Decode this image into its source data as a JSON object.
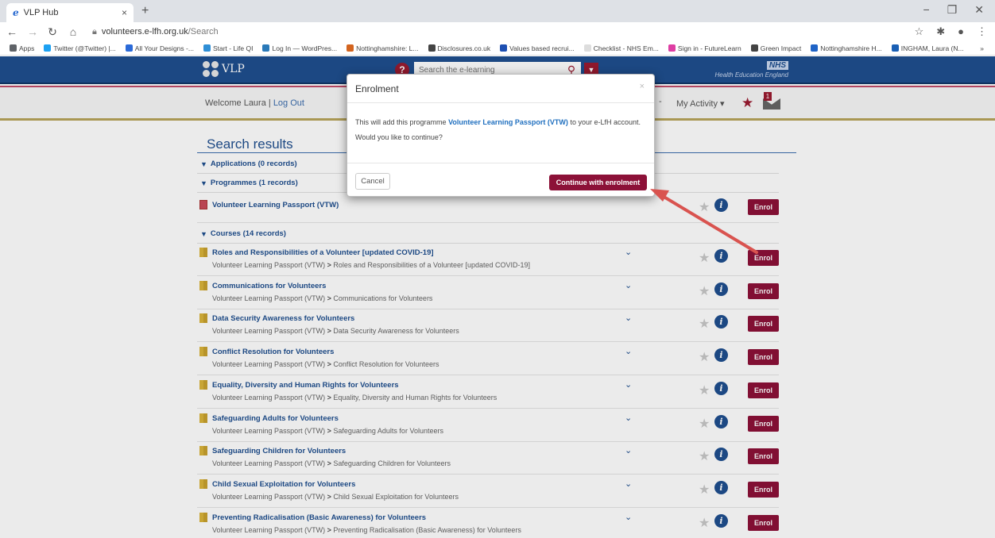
{
  "browser": {
    "tab_title": "VLP Hub",
    "tab_favicon": "e",
    "tab_close": "×",
    "newtab": "+",
    "url_domain": "volunteers.e-lfh.org.uk",
    "url_path": "/Search",
    "bookmarks": [
      {
        "label": "Apps",
        "color": "#5f6368"
      },
      {
        "label": "Twitter (@Twitter) |...",
        "color": "#1da1f2"
      },
      {
        "label": "All Your Designs -...",
        "color": "#2b6ad8"
      },
      {
        "label": "Start - Life QI",
        "color": "#2f8fd6"
      },
      {
        "label": "Log In — WordPres...",
        "color": "#2a79b8"
      },
      {
        "label": "Nottinghamshire: L...",
        "color": "#d3641f"
      },
      {
        "label": "Disclosures.co.uk",
        "color": "#444444"
      },
      {
        "label": "Values based recrui...",
        "color": "#1d4fb2"
      },
      {
        "label": "Checklist - NHS Em...",
        "color": "#dddddd"
      },
      {
        "label": "Sign in - FutureLearn",
        "color": "#de3ea3"
      },
      {
        "label": "Green Impact",
        "color": "#444444"
      },
      {
        "label": "Nottinghamshire H...",
        "color": "#1f63c6"
      },
      {
        "label": "INGHAM, Laura (N...",
        "color": "#1a5fb4"
      }
    ],
    "bookmarks_more": "»"
  },
  "header": {
    "logo_text": "VLP",
    "search_placeholder": "Search the e-learning",
    "help_label": "?",
    "nhs_logo": "NHS",
    "nhs_sub": "Health Education England"
  },
  "subnav": {
    "welcome": "Welcome Laura |",
    "logout": "Log Out",
    "dash": "-",
    "my_activity": "My Activity",
    "mail_count": "1"
  },
  "results": {
    "title": "Search results",
    "applications_label": "Applications (0 records)",
    "programmes_label": "Programmes (1 records)",
    "courses_label": "Courses (14 records)",
    "enrol_label": "Enrol",
    "programme": {
      "title": "Volunteer Learning Passport (VTW)"
    },
    "path_prefix": "Volunteer Learning Passport (VTW)",
    "path_sep": ">",
    "courses": [
      {
        "title": "Roles and Responsibilities of a Volunteer [updated COVID-19]",
        "path": "Roles and Responsibilities of a Volunteer [updated COVID-19]"
      },
      {
        "title": "Communications for Volunteers",
        "path": "Communications for Volunteers"
      },
      {
        "title": "Data Security Awareness for Volunteers",
        "path": "Data Security Awareness for Volunteers"
      },
      {
        "title": "Conflict Resolution for Volunteers",
        "path": "Conflict Resolution for Volunteers"
      },
      {
        "title": "Equality, Diversity and Human Rights for Volunteers",
        "path": "Equality, Diversity and Human Rights for Volunteers"
      },
      {
        "title": "Safeguarding Adults for Volunteers",
        "path": "Safeguarding Adults for Volunteers"
      },
      {
        "title": "Safeguarding Children for Volunteers",
        "path": "Safeguarding Children for Volunteers"
      },
      {
        "title": "Child Sexual Exploitation for Volunteers",
        "path": "Child Sexual Exploitation for Volunteers"
      },
      {
        "title": "Preventing Radicalisation (Basic Awareness) for Volunteers",
        "path": "Preventing Radicalisation (Basic Awareness) for Volunteers"
      }
    ]
  },
  "modal": {
    "title": "Enrolment",
    "close": "×",
    "body_prefix": "This will add this programme",
    "programme_name": "Volunteer Learning Passport (VTW)",
    "body_suffix": "to your e-LfH account.",
    "question": "Would you like to continue?",
    "cancel_label": "Cancel",
    "continue_label": "Continue with enrolment"
  },
  "colors": {
    "header_blue": "#1f4f8f",
    "enrol_maroon": "#8c1138",
    "arrow_red": "#d9534f"
  }
}
